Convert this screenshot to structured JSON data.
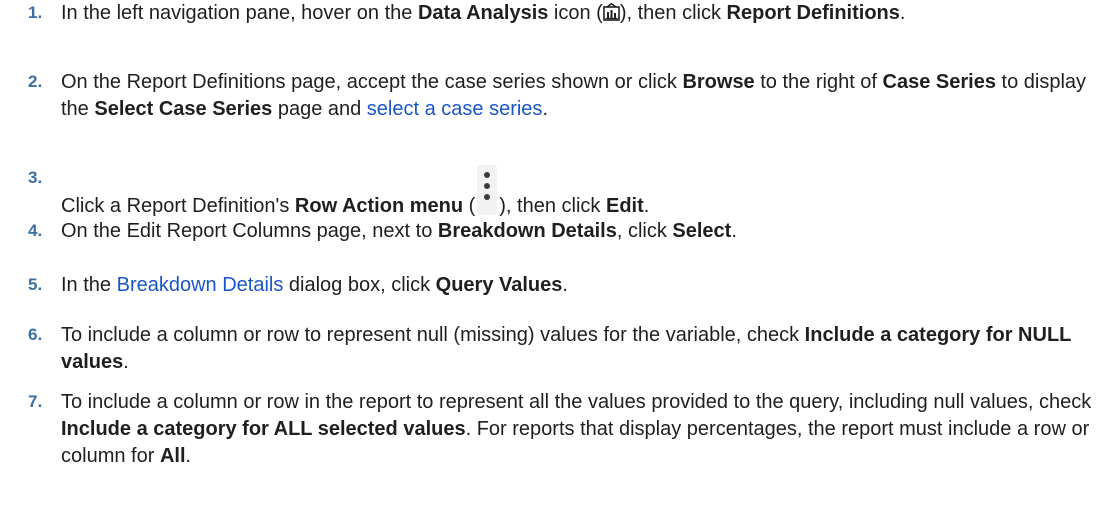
{
  "steps": [
    {
      "number": "1.",
      "parts": [
        {
          "t": "In the left navigation pane, hover on the "
        },
        {
          "t": "Data Analysis",
          "s": "b"
        },
        {
          "t": " icon ("
        },
        {
          "icon": "data-analysis-icon"
        },
        {
          "t": "), then click "
        },
        {
          "t": "Report Definitions",
          "s": "b"
        },
        {
          "t": "."
        }
      ]
    },
    {
      "number": "2.",
      "parts": [
        {
          "t": "On the Report Definitions page, accept the case series shown or click "
        },
        {
          "t": "Browse",
          "s": "b"
        },
        {
          "t": " to the right of "
        },
        {
          "t": "Case Series",
          "s": "b"
        },
        {
          "t": " to display the "
        },
        {
          "t": "Select Case Series",
          "s": "b"
        },
        {
          "t": " page and "
        },
        {
          "t": "select a case series",
          "s": "link"
        },
        {
          "t": "."
        }
      ]
    },
    {
      "number": "3.",
      "parts": [
        {
          "t": "Click a Report Definition's "
        },
        {
          "t": "Row Action menu",
          "s": "b"
        },
        {
          "t": " ("
        },
        {
          "icon": "row-action-menu-icon"
        },
        {
          "t": "), then click "
        },
        {
          "t": "Edit",
          "s": "b"
        },
        {
          "t": "."
        }
      ]
    },
    {
      "number": "4.",
      "parts": [
        {
          "t": "On the Edit Report Columns page, next to "
        },
        {
          "t": "Breakdown Details",
          "s": "b"
        },
        {
          "t": ", click "
        },
        {
          "t": "Select",
          "s": "b"
        },
        {
          "t": "."
        }
      ]
    },
    {
      "number": "5.",
      "parts": [
        {
          "t": "In the "
        },
        {
          "t": "Breakdown Details",
          "s": "link"
        },
        {
          "t": " dialog box, click "
        },
        {
          "t": "Query Values",
          "s": "b"
        },
        {
          "t": "."
        }
      ]
    },
    {
      "number": "6.",
      "parts": [
        {
          "t": "To include a column or row to represent null (missing) values for the variable, check "
        },
        {
          "t": "Include a category for NULL values",
          "s": "b"
        },
        {
          "t": "."
        }
      ]
    },
    {
      "number": "7.",
      "parts": [
        {
          "t": "To include a column or row in the report to represent all the values provided to the query, including null values, check "
        },
        {
          "t": "Include a category for ALL selected values",
          "s": "b"
        },
        {
          "t": ". For reports that display percentages, the report must include a row or column for "
        },
        {
          "t": "All",
          "s": "b"
        },
        {
          "t": "."
        }
      ]
    }
  ]
}
